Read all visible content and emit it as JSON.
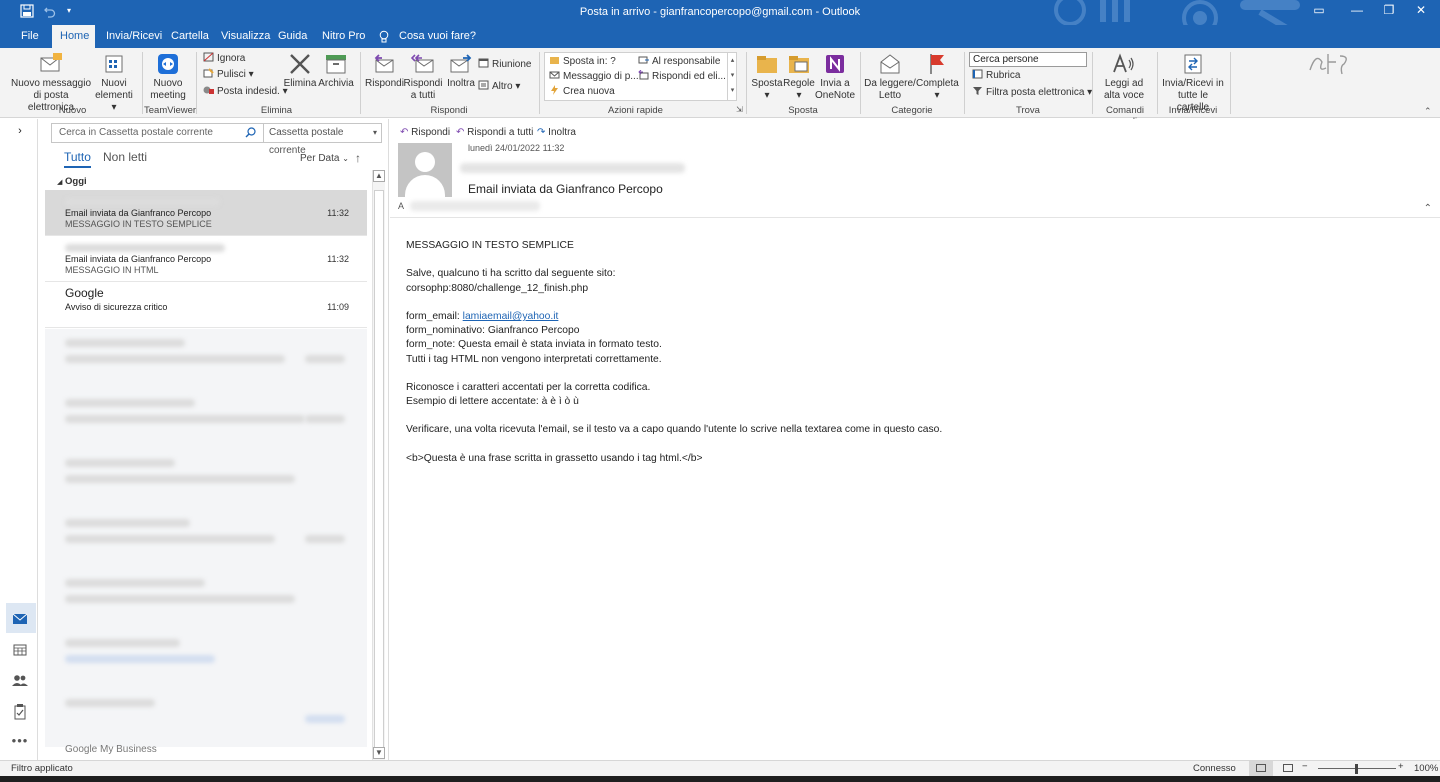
{
  "titlebar": {
    "title": "Posta in arrivo - gianfrancopercopo@gmail.com - Outlook",
    "save_icon": "save-icon",
    "undo_icon": "undo-icon",
    "customize_icon": "chevron-down-icon",
    "accent": "#1e64b4"
  },
  "tabs": {
    "file": "File",
    "home": "Home",
    "send_receive": "Invia/Ricevi",
    "folder": "Cartella",
    "view": "Visualizza",
    "help": "Guida",
    "nitro": "Nitro Pro",
    "tell_me": "Cosa vuoi fare?"
  },
  "ribbon": {
    "new_email_l1": "Nuovo messaggio",
    "new_email_l2": "di posta elettronica",
    "new_items_l1": "Nuovi",
    "new_items_l2": "elementi",
    "group_new": "Nuovo",
    "new_meeting_l1": "Nuovo",
    "new_meeting_l2": "meeting",
    "group_teamviewer": "TeamViewer",
    "ignore": "Ignora",
    "cleanup": "Pulisci",
    "junk": "Posta indesid.",
    "delete": "Elimina",
    "archive": "Archivia",
    "group_delete": "Elimina",
    "reply": "Rispondi",
    "reply_all_l1": "Rispondi",
    "reply_all_l2": "a tutti",
    "forward": "Inoltra",
    "meeting": "Riunione",
    "more": "Altro",
    "group_respond": "Rispondi",
    "qs_move": "Sposta in: ?",
    "qs_manager": "Al responsabile",
    "qs_team": "Messaggio di p...",
    "qs_reply_delete": "Rispondi ed eli...",
    "qs_create": "Crea nuova",
    "group_quicksteps": "Azioni rapide",
    "move": "Sposta",
    "rules": "Regole",
    "onenote_l1": "Invia a",
    "onenote_l2": "OneNote",
    "group_move": "Sposta",
    "unread_l1": "Da leggere/",
    "unread_l2": "Letto",
    "followup": "Completa",
    "group_tags": "Categorie",
    "search_people": "Cerca persone",
    "address_book": "Rubrica",
    "filter_email": "Filtra posta elettronica",
    "group_find": "Trova",
    "read_aloud_l1": "Leggi ad",
    "read_aloud_l2": "alta voce",
    "group_voice": "Comandi vocali",
    "sendrecv_all_l1": "Invia/Ricevi in",
    "sendrecv_all_l2": "tutte le cartelle",
    "group_sendrecv": "Invia/Ricevi"
  },
  "list": {
    "search_placeholder": "Cerca in Cassetta postale corrente",
    "scope": "Cassetta postale corrente",
    "filter_all": "Tutto",
    "filter_unread": "Non letti",
    "sort": "Per Data",
    "group_today": "Oggi",
    "items": [
      {
        "subject": "Email inviata da Gianfranco Percopo",
        "preview": "MESSAGGIO IN TESTO SEMPLICE",
        "time": "11:32"
      },
      {
        "subject": "Email inviata da Gianfranco Percopo",
        "preview": "MESSAGGIO IN HTML",
        "time": "11:32"
      },
      {
        "sender": "Google",
        "subject": "Avviso di sicurezza critico",
        "time": "11:09"
      }
    ],
    "last_sender": "Google My Business",
    "selected_color": "#d9d9d9"
  },
  "reader": {
    "reply": "Rispondi",
    "reply_all": "Rispondi a tutti",
    "forward": "Inoltra",
    "date": "lunedì 24/01/2022 11:32",
    "subject": "Email inviata da Gianfranco Percopo",
    "to_label": "A",
    "body": {
      "l1": "MESSAGGIO IN TESTO SEMPLICE",
      "l2": "Salve, qualcuno ti ha scritto dal seguente sito:",
      "l3": "corsophp:8080/challenge_12_finish.php",
      "l4_label": "form_email: ",
      "l4_link": "lamiaemail@yahoo.it",
      "l5": "form_nominativo: Gianfranco Percopo",
      "l6": "form_note: Questa email è stata inviata in formato testo.",
      "l7": "Tutti i tag HTML non vengono interpretati correttamente.",
      "l8": "Riconosce i caratteri accentati per la corretta codifica.",
      "l9": "Esempio di lettere accentate: à è ì ò ù",
      "l10": "Verificare, una volta ricevuta l'email, se il testo va a capo quando l'utente lo scrive nella textarea come in questo caso.",
      "l11": "<b>Questa è una frase scritta in grassetto usando i tag html.</b>"
    }
  },
  "status": {
    "filter": "Filtro applicato",
    "connection": "Connesso",
    "zoom": "100%"
  }
}
